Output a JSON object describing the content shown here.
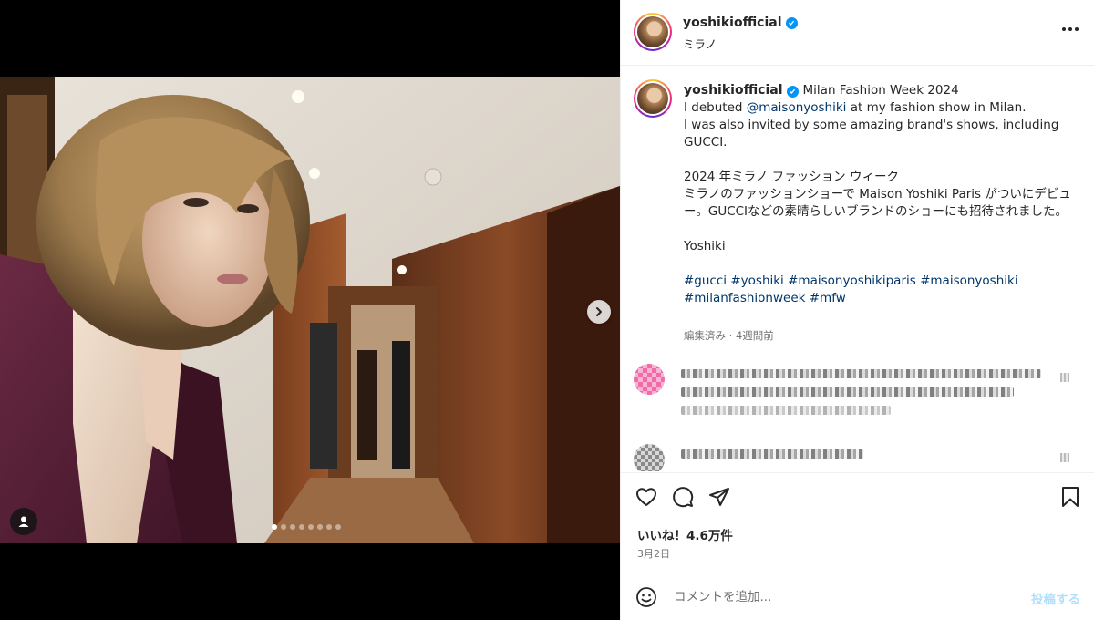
{
  "post": {
    "username": "yoshikiofficial",
    "location": "ミラノ",
    "image_count": 8,
    "active_image_index": 0
  },
  "caption": {
    "username": "yoshikiofficial",
    "first_line": "Milan Fashion Week 2024",
    "line_debut_before": "I debuted ",
    "mention": "@maisonyoshiki",
    "line_debut_after": " at my fashion show in Milan.",
    "line_invited": "I was also invited by some amazing brand's shows, including GUCCI.",
    "jp_title": "2024 年ミラノ ファッション ウィーク",
    "jp_body": "ミラノのファッションショーで Maison Yoshiki Paris がついにデビュー。GUCCIなどの素晴らしいブランドのショーにも招待されました。",
    "signature": "Yoshiki",
    "hashtags": [
      "#gucci",
      "#yoshiki",
      "#maisonyoshikiparis",
      "#maisonyoshiki",
      "#milanfashionweek",
      "#mfw"
    ],
    "meta": "編集済み · 4週間前"
  },
  "engagement": {
    "likes": "いいね！4.6万件",
    "date": "3月2日"
  },
  "comment_box": {
    "placeholder": "コメントを追加...",
    "post_label": "投稿する"
  },
  "colors": {
    "link": "#00376b",
    "verified": "#0095f6",
    "muted": "#737373",
    "post_disabled": "#b2dffc"
  },
  "icons": [
    "more-options-icon",
    "verified-badge-icon",
    "next-arrow-icon",
    "tag-user-icon",
    "heart-icon",
    "comment-icon",
    "share-icon",
    "bookmark-icon",
    "emoji-icon"
  ]
}
